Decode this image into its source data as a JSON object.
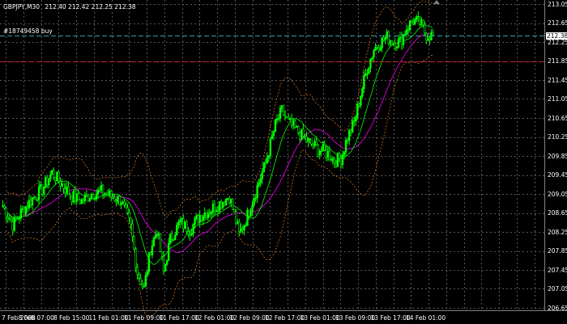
{
  "header": {
    "symbol": "GBPJPY,M30",
    "quote": "212.40 212.42 212.25 212.38"
  },
  "order_label": "#18749458 buy",
  "price_scale": {
    "min": 206.65,
    "max": 213.05,
    "ticks": [
      "213.05",
      "212.65",
      "212.25",
      "211.85",
      "211.45",
      "211.05",
      "210.65",
      "210.25",
      "209.85",
      "209.45",
      "209.05",
      "208.65",
      "208.25",
      "207.85",
      "207.45",
      "207.05",
      "206.65"
    ],
    "current_price": "212.38",
    "order_level_price": 212.38,
    "stop_level_price": 211.85
  },
  "time_scale": {
    "ticks": [
      "7 Feb 2008",
      "8 Feb 07:00",
      "8 Feb 15:00",
      "11 Feb 01:00",
      "11 Feb 09:00",
      "11 Feb 17:00",
      "12 Feb 01:00",
      "12 Feb 09:00",
      "12 Feb 17:00",
      "13 Feb 01:00",
      "13 Feb 09:00",
      "13 Feb 17:00",
      "14 Feb 01:00"
    ]
  },
  "colors": {
    "background": "#000000",
    "grid": "#5a5a5a",
    "candle": "#00ff00",
    "ma_fast": "#00ff00",
    "ma_slow": "#cc00cc",
    "bands": "#c87020",
    "order_line": "#3aa0a0",
    "stop_line": "#cc2020",
    "text": "#ffffff"
  },
  "icons": {
    "scroll_marker": "triangle-up-icon"
  }
}
